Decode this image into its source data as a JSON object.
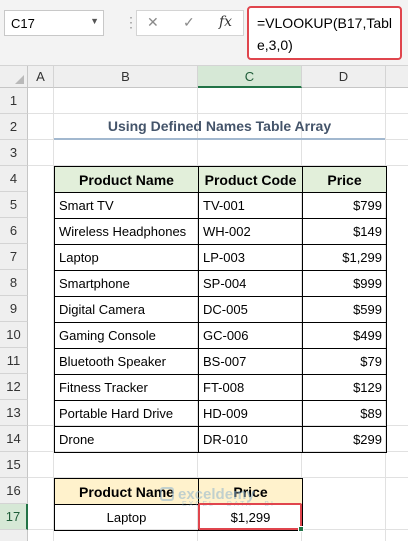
{
  "formula_bar": {
    "name_box": "C17",
    "cancel": "✕",
    "confirm": "✓",
    "fx": "fx",
    "formula": "=VLOOKUP(B17,Table,3,0)"
  },
  "columns": [
    "A",
    "B",
    "C",
    "D"
  ],
  "rows": [
    "1",
    "2",
    "3",
    "4",
    "5",
    "6",
    "7",
    "8",
    "9",
    "10",
    "11",
    "12",
    "13",
    "14",
    "15",
    "16",
    "17"
  ],
  "title": "Using Defined Names Table Array",
  "table": {
    "headers": [
      "Product Name",
      "Product Code",
      "Price"
    ],
    "rows": [
      [
        "Smart TV",
        "TV-001",
        "$799"
      ],
      [
        "Wireless Headphones",
        "WH-002",
        "$149"
      ],
      [
        "Laptop",
        "LP-003",
        "$1,299"
      ],
      [
        "Smartphone",
        "SP-004",
        "$999"
      ],
      [
        "Digital Camera",
        "DC-005",
        "$599"
      ],
      [
        "Gaming Console",
        "GC-006",
        "$499"
      ],
      [
        "Bluetooth Speaker",
        "BS-007",
        "$79"
      ],
      [
        "Fitness Tracker",
        "FT-008",
        "$129"
      ],
      [
        "Portable Hard Drive",
        "HD-009",
        "$89"
      ],
      [
        "Drone",
        "DR-010",
        "$299"
      ]
    ]
  },
  "lookup": {
    "headers": [
      "Product Name",
      "Price"
    ],
    "product": "Laptop",
    "price": "$1,299"
  },
  "watermark": {
    "name": "exceldemy",
    "tagline": "EXCEL · DATA · BI"
  }
}
